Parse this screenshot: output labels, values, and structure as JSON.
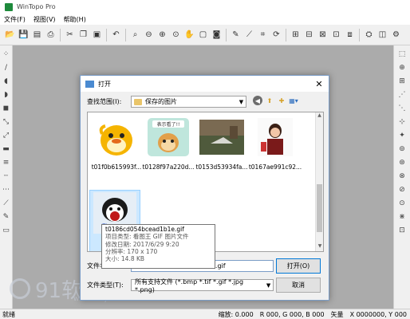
{
  "app": {
    "title": "WinTopo Pro"
  },
  "menu": [
    "文件(F)",
    "视图(V)",
    "帮助(H)"
  ],
  "dialog": {
    "title": "打开",
    "look_in_label": "查找范围(I):",
    "look_in_value": "保存的图片",
    "files": [
      {
        "name": "t01f0b615993f...",
        "thumb": "duck"
      },
      {
        "name": "t0128f97a220d...",
        "thumb": "monkey",
        "caption": "表示看了!!"
      },
      {
        "name": "t0153d53934fa...",
        "thumb": "photo"
      },
      {
        "name": "t0167ae991c92...",
        "thumb": "person"
      },
      {
        "name": "t0186cd054bcead1b1e.gif",
        "name_a": "t0186",
        "name_b": "d",
        "thumb": "face",
        "caption": "我"
      }
    ],
    "tooltip": [
      "t0186cd054bcead1b1e.gif",
      "项目类型: 看图王 GIF 图片文件",
      "修改日期: 2017/6/29 9:20",
      "分辨率: 170 x 170",
      "大小: 14.8 KB"
    ],
    "filename_label": "文件名",
    "filename_value": "e.gif",
    "filetype_label": "文件类型(T):",
    "filetype_value": "所有支持文件 (*.bmp *.tif *.gif *.jpg *.png)",
    "open_label": "打开(O)",
    "cancel_label": "取消"
  },
  "status": {
    "ready": "就绪",
    "zoom": "缩放: 0.000",
    "rgb": "R 000, G 000, B 000",
    "vector": "矢量",
    "x": "X 0000000, Y 000"
  },
  "watermark": {
    "text": "91软件站",
    "url": "www.91rjz.com"
  }
}
